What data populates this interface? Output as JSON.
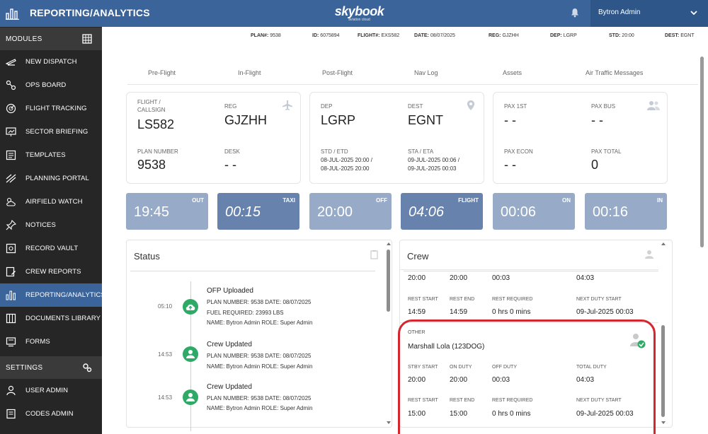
{
  "header": {
    "app_title": "REPORTING/ANALYTICS",
    "brand_name": "skybook",
    "brand_tagline": "aviation cloud",
    "user_name": "Bytron Admin"
  },
  "sidebar": {
    "modules_label": "MODULES",
    "settings_label": "SETTINGS",
    "items": [
      {
        "label": "NEW DISPATCH",
        "icon": "plane-takeoff-icon"
      },
      {
        "label": "OPS BOARD",
        "icon": "ops-board-icon"
      },
      {
        "label": "FLIGHT TRACKING",
        "icon": "radar-icon"
      },
      {
        "label": "SECTOR BRIEFING",
        "icon": "briefing-icon"
      },
      {
        "label": "TEMPLATES",
        "icon": "templates-icon"
      },
      {
        "label": "PLANNING PORTAL",
        "icon": "planning-icon"
      },
      {
        "label": "AIRFIELD WATCH",
        "icon": "weather-icon"
      },
      {
        "label": "NOTICES",
        "icon": "pin-icon"
      },
      {
        "label": "RECORD VAULT",
        "icon": "vault-icon"
      },
      {
        "label": "CREW REPORTS",
        "icon": "crew-report-icon"
      },
      {
        "label": "REPORTING/ANALYTICS",
        "icon": "bar-chart-icon"
      },
      {
        "label": "DOCUMENTS LIBRARY",
        "icon": "library-icon"
      },
      {
        "label": "FORMS",
        "icon": "forms-icon"
      }
    ],
    "settings_items": [
      {
        "label": "USER ADMIN",
        "icon": "user-icon"
      },
      {
        "label": "CODES ADMIN",
        "icon": "codes-icon"
      }
    ]
  },
  "flight_info": {
    "plan": {
      "label": "PLAN#:",
      "value": "9538"
    },
    "id": {
      "label": "ID:",
      "value": "6075894"
    },
    "flight": {
      "label": "FLIGHT#:",
      "value": "EXS582"
    },
    "date": {
      "label": "DATE:",
      "value": "08/07/2025"
    },
    "reg": {
      "label": "REG:",
      "value": "GJZHH"
    },
    "dep": {
      "label": "DEP:",
      "value": "LGRP"
    },
    "std": {
      "label": "STD:",
      "value": "20:00"
    },
    "dest": {
      "label": "DEST:",
      "value": "EGNT"
    }
  },
  "tabs": [
    "Pre-Flight",
    "In-Flight",
    "Post-Flight",
    "Nav Log",
    "Assets",
    "Air Traffic Messages"
  ],
  "card_flight": {
    "flight_label_1": "FLIGHT /",
    "flight_label_2": "CALLSIGN",
    "flight_value": "LS582",
    "reg_label": "REG",
    "reg_value": "GJZHH",
    "plan_label": "PLAN NUMBER",
    "plan_value": "9538",
    "desk_label": "DESK",
    "desk_value": "- -"
  },
  "card_route": {
    "dep_label": "DEP",
    "dep_value": "LGRP",
    "dest_label": "DEST",
    "dest_value": "EGNT",
    "std_label": "STD / ETD",
    "std_line1": "08-JUL-2025 20:00 /",
    "std_line2": "08-JUL-2025 20:00",
    "sta_label": "STA / ETA",
    "sta_line1": "09-JUL-2025 00:06 /",
    "sta_line2": "09-JUL-2025 00:03"
  },
  "card_pax": {
    "pax1_label": "PAX 1ST",
    "pax1_value": "- -",
    "paxbus_label": "PAX BUS",
    "paxbus_value": "- -",
    "paxecon_label": "PAX ECON",
    "paxecon_value": "- -",
    "paxtotal_label": "PAX TOTAL",
    "paxtotal_value": "0"
  },
  "times": [
    {
      "value": "19:45",
      "tag": "OUT",
      "style": "light"
    },
    {
      "value": "00:15",
      "tag": "TAXI",
      "style": "dark"
    },
    {
      "value": "20:00",
      "tag": "OFF",
      "style": "light"
    },
    {
      "value": "04:06",
      "tag": "FLIGHT",
      "style": "dark"
    },
    {
      "value": "00:06",
      "tag": "ON",
      "style": "light"
    },
    {
      "value": "00:16",
      "tag": "IN",
      "style": "light"
    }
  ],
  "status": {
    "title": "Status",
    "events": [
      {
        "time": "05:10",
        "title": "OFP Uploaded",
        "lines": [
          "PLAN NUMBER: 9538 DATE: 08/07/2025",
          "FUEL REQUIRED: 23993 LBS",
          "NAME: Bytron Admin ROLE: Super Admin"
        ],
        "icon": "cloud-upload-icon"
      },
      {
        "time": "14:53",
        "title": "Crew Updated",
        "lines": [
          "PLAN NUMBER: 9538 DATE: 08/07/2025",
          "NAME: Bytron Admin ROLE: Super Admin"
        ],
        "icon": "person-icon"
      },
      {
        "time": "14:53",
        "title": "Crew Updated",
        "lines": [
          "PLAN NUMBER: 9538 DATE: 08/07/2025",
          "NAME: Bytron Admin ROLE: Super Admin"
        ],
        "icon": "person-icon"
      }
    ]
  },
  "crew": {
    "title": "Crew",
    "prev_row1": {
      "stby_start": "20:00",
      "on_duty": "20:00",
      "off_duty": "00:03",
      "total_duty": "04:03"
    },
    "prev_row2": {
      "rest_start": "14:59",
      "rest_end": "14:59",
      "rest_required": "0 hrs 0 mins",
      "next_duty_start": "09-Jul-2025 00:03"
    },
    "labels": {
      "stby_start": "STBY START",
      "on_duty": "ON DUTY",
      "off_duty": "OFF DUTY",
      "total_duty": "TOTAL DUTY",
      "rest_start": "REST START",
      "rest_end": "REST END",
      "rest_required": "REST REQUIRED",
      "next_duty_start": "NEXT DUTY START"
    },
    "member": {
      "role": "OTHER",
      "name": "Marshall Lola (123DOG)",
      "stby_start": "20:00",
      "on_duty": "20:00",
      "off_duty": "00:03",
      "total_duty": "04:03",
      "rest_start": "15:00",
      "rest_end": "15:00",
      "rest_required": "0 hrs 0 mins",
      "next_duty_start": "09-Jul-2025 00:03"
    }
  },
  "colors": {
    "header": "#3b649b",
    "sidebar": "#262626",
    "active_item": "#3b649b",
    "tile_light": "#97abc8",
    "tile_dark": "#6682ad",
    "status_green": "#2eaa66",
    "highlight_ring": "#d3262e"
  }
}
